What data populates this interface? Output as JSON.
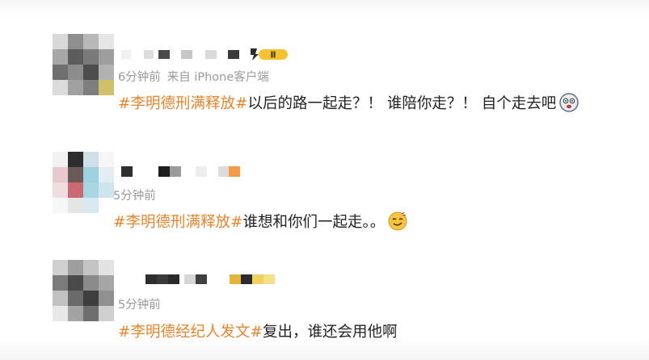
{
  "posts": [
    {
      "time": "6分钟前",
      "source": "来自 iPhone客户端",
      "hashtag": "#李明德刑满释放#",
      "text": "以后的路一起走？！ 谁陪你走？！ 自个走去吧",
      "emoji": "dizzy-face-emoji",
      "badge_level": "Ⅱ"
    },
    {
      "time": "5分钟前",
      "hashtag": "#李明德刑满释放#",
      "text": "谁想和你们一起走。。",
      "emoji": "smirk-face-emoji"
    },
    {
      "time": "5分钟前",
      "hashtag": "#李明德经纪人发文#",
      "text": "复出，谁还会用他啊"
    }
  ],
  "colors": {
    "hashtag": "#e8842c",
    "text": "#222222",
    "meta": "#9a9a9a",
    "badge_bg": "#f5c232"
  }
}
